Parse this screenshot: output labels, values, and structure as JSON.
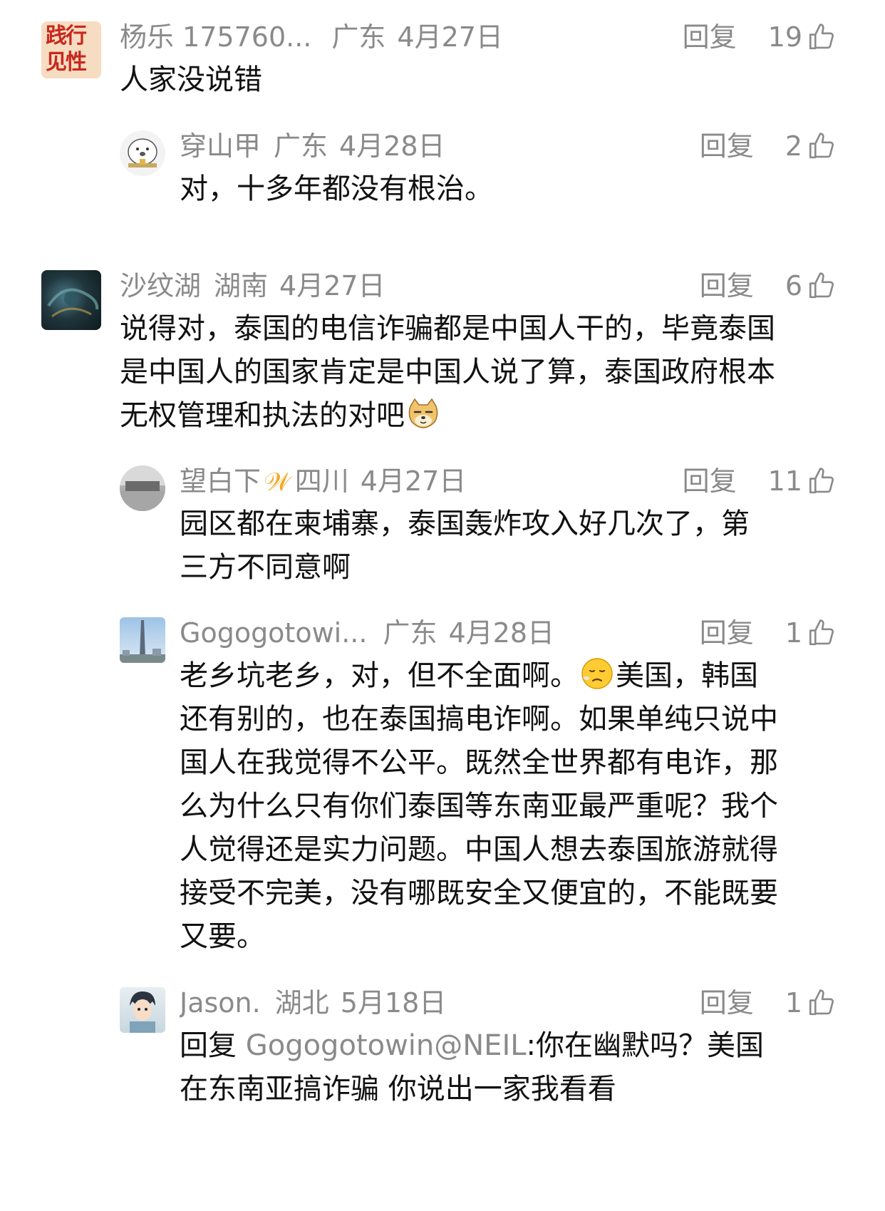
{
  "comments": [
    {
      "user": "杨乐 175760...",
      "location": "广东",
      "date": "4月27日",
      "reply_label": "回复",
      "likes": "19",
      "text": "人家没说错",
      "avatar_text": "践行见性"
    },
    {
      "user": "穿山甲",
      "location": "广东",
      "date": "4月28日",
      "reply_label": "回复",
      "likes": "2",
      "text": "对，十多年都没有根治。"
    },
    {
      "user": "沙纹湖",
      "location": "湖南",
      "date": "4月27日",
      "reply_label": "回复",
      "likes": "6",
      "text": "说得对，泰国的电信诈骗都是中国人干的，毕竟泰国是中国人的国家肯定是中国人说了算，泰国政府根本无权管理和执法的对吧"
    },
    {
      "user": "望白下",
      "badge": "𝒲",
      "location": "四川",
      "date": "4月27日",
      "reply_label": "回复",
      "likes": "11",
      "text": "园区都在柬埔寨，泰国轰炸攻入好几次了，第三方不同意啊"
    },
    {
      "user": "Gogogotowi...",
      "location": "广东",
      "date": "4月28日",
      "reply_label": "回复",
      "likes": "1",
      "text_a": "老乡坑老乡，对，但不全面啊。",
      "text_b": "美国，韩国还有别的，也在泰国搞电诈啊。如果单纯只说中国人在我觉得不公平。既然全世界都有电诈，那么为什么只有你们泰国等东南亚最严重呢？我个人觉得还是实力问题。中国人想去泰国旅游就得接受不完美，没有哪既安全又便宜的，不能既要又要。"
    },
    {
      "user": "Jason.",
      "location": "湖北",
      "date": "5月18日",
      "reply_label": "回复",
      "likes": "1",
      "reply_prefix": "回复",
      "mention": "Gogogotowin@NEIL",
      "text": ":你在幽默吗？美国在东南亚搞诈骗 你说出一家我看看"
    }
  ]
}
